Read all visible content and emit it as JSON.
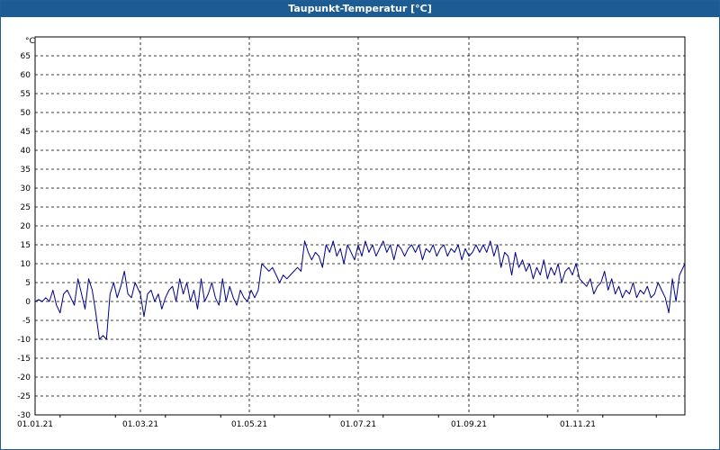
{
  "window": {
    "title": "Taupunkt-Temperatur [°C]"
  },
  "chart_data": {
    "type": "line",
    "title": "Taupunkt-Temperatur [°C]",
    "ylabel": "°C",
    "xlabel": "",
    "ylim": [
      -30,
      70
    ],
    "xlim": [
      "2021-01-01",
      "2021-12-31"
    ],
    "grid": true,
    "yticks": [
      65,
      60,
      55,
      50,
      45,
      40,
      35,
      30,
      25,
      20,
      15,
      10,
      5,
      0,
      -5,
      -10,
      -15,
      -20,
      -25,
      -30
    ],
    "xticks": [
      {
        "date": "2021-01-01",
        "label": "01.01.21"
      },
      {
        "date": "2021-03-01",
        "label": "01.03.21"
      },
      {
        "date": "2021-05-01",
        "label": "01.05.21"
      },
      {
        "date": "2021-07-01",
        "label": "01.07.21"
      },
      {
        "date": "2021-09-01",
        "label": "01.09.21"
      },
      {
        "date": "2021-11-01",
        "label": "01.11.21"
      }
    ],
    "series": [
      {
        "color": "#00008b",
        "points": [
          [
            "2021-01-01",
            0
          ],
          [
            "2021-01-03",
            0.5
          ],
          [
            "2021-01-05",
            0
          ],
          [
            "2021-01-07",
            1
          ],
          [
            "2021-01-09",
            0
          ],
          [
            "2021-01-11",
            3
          ],
          [
            "2021-01-13",
            -1
          ],
          [
            "2021-01-15",
            -3
          ],
          [
            "2021-01-17",
            2
          ],
          [
            "2021-01-19",
            3
          ],
          [
            "2021-01-21",
            1
          ],
          [
            "2021-01-23",
            -1
          ],
          [
            "2021-01-25",
            6
          ],
          [
            "2021-01-27",
            2
          ],
          [
            "2021-01-29",
            -2
          ],
          [
            "2021-01-31",
            6
          ],
          [
            "2021-02-02",
            3
          ],
          [
            "2021-02-04",
            -3
          ],
          [
            "2021-02-06",
            -10
          ],
          [
            "2021-02-08",
            -9
          ],
          [
            "2021-02-10",
            -10
          ],
          [
            "2021-02-12",
            2
          ],
          [
            "2021-02-14",
            5
          ],
          [
            "2021-02-16",
            1
          ],
          [
            "2021-02-18",
            4
          ],
          [
            "2021-02-20",
            8
          ],
          [
            "2021-02-22",
            2
          ],
          [
            "2021-02-24",
            1
          ],
          [
            "2021-02-26",
            5
          ],
          [
            "2021-03-01",
            2
          ],
          [
            "2021-03-03",
            -4
          ],
          [
            "2021-03-05",
            2
          ],
          [
            "2021-03-07",
            3
          ],
          [
            "2021-03-09",
            0
          ],
          [
            "2021-03-11",
            2
          ],
          [
            "2021-03-13",
            -2
          ],
          [
            "2021-03-15",
            1
          ],
          [
            "2021-03-17",
            3
          ],
          [
            "2021-03-19",
            4
          ],
          [
            "2021-03-21",
            0
          ],
          [
            "2021-03-23",
            6
          ],
          [
            "2021-03-25",
            2
          ],
          [
            "2021-03-27",
            5
          ],
          [
            "2021-03-29",
            0
          ],
          [
            "2021-03-31",
            3
          ],
          [
            "2021-04-02",
            -2
          ],
          [
            "2021-04-04",
            6
          ],
          [
            "2021-04-06",
            0
          ],
          [
            "2021-04-08",
            2
          ],
          [
            "2021-04-10",
            5
          ],
          [
            "2021-04-12",
            1
          ],
          [
            "2021-04-14",
            -1
          ],
          [
            "2021-04-16",
            6
          ],
          [
            "2021-04-18",
            0
          ],
          [
            "2021-04-20",
            4
          ],
          [
            "2021-04-22",
            1
          ],
          [
            "2021-04-24",
            -1
          ],
          [
            "2021-04-26",
            3
          ],
          [
            "2021-04-28",
            1
          ],
          [
            "2021-04-30",
            0
          ],
          [
            "2021-05-02",
            3
          ],
          [
            "2021-05-04",
            1
          ],
          [
            "2021-05-06",
            3
          ],
          [
            "2021-05-08",
            10
          ],
          [
            "2021-05-10",
            9
          ],
          [
            "2021-05-12",
            8
          ],
          [
            "2021-05-14",
            9
          ],
          [
            "2021-05-16",
            7
          ],
          [
            "2021-05-18",
            5
          ],
          [
            "2021-05-20",
            7
          ],
          [
            "2021-05-22",
            6
          ],
          [
            "2021-05-24",
            7
          ],
          [
            "2021-05-26",
            8
          ],
          [
            "2021-05-28",
            9
          ],
          [
            "2021-05-30",
            8
          ],
          [
            "2021-06-01",
            16
          ],
          [
            "2021-06-03",
            13
          ],
          [
            "2021-06-05",
            11
          ],
          [
            "2021-06-07",
            13
          ],
          [
            "2021-06-09",
            12
          ],
          [
            "2021-06-11",
            9
          ],
          [
            "2021-06-13",
            15
          ],
          [
            "2021-06-15",
            13
          ],
          [
            "2021-06-17",
            16
          ],
          [
            "2021-06-19",
            12
          ],
          [
            "2021-06-21",
            14
          ],
          [
            "2021-06-23",
            10
          ],
          [
            "2021-06-25",
            15
          ],
          [
            "2021-06-27",
            13
          ],
          [
            "2021-06-29",
            11
          ],
          [
            "2021-07-01",
            15
          ],
          [
            "2021-07-03",
            12
          ],
          [
            "2021-07-05",
            16
          ],
          [
            "2021-07-07",
            13
          ],
          [
            "2021-07-09",
            15
          ],
          [
            "2021-07-11",
            12
          ],
          [
            "2021-07-13",
            14
          ],
          [
            "2021-07-15",
            16
          ],
          [
            "2021-07-17",
            13
          ],
          [
            "2021-07-19",
            15
          ],
          [
            "2021-07-21",
            11
          ],
          [
            "2021-07-23",
            15
          ],
          [
            "2021-07-25",
            14
          ],
          [
            "2021-07-27",
            12
          ],
          [
            "2021-07-29",
            14
          ],
          [
            "2021-07-31",
            15
          ],
          [
            "2021-08-02",
            13
          ],
          [
            "2021-08-04",
            15
          ],
          [
            "2021-08-06",
            11
          ],
          [
            "2021-08-08",
            14
          ],
          [
            "2021-08-10",
            13
          ],
          [
            "2021-08-12",
            15
          ],
          [
            "2021-08-14",
            12
          ],
          [
            "2021-08-16",
            14
          ],
          [
            "2021-08-18",
            15
          ],
          [
            "2021-08-20",
            12
          ],
          [
            "2021-08-22",
            14
          ],
          [
            "2021-08-24",
            13
          ],
          [
            "2021-08-26",
            15
          ],
          [
            "2021-08-28",
            11
          ],
          [
            "2021-08-30",
            14
          ],
          [
            "2021-09-01",
            12
          ],
          [
            "2021-09-03",
            13
          ],
          [
            "2021-09-05",
            15
          ],
          [
            "2021-09-07",
            13
          ],
          [
            "2021-09-09",
            15
          ],
          [
            "2021-09-11",
            13
          ],
          [
            "2021-09-13",
            16
          ],
          [
            "2021-09-15",
            12
          ],
          [
            "2021-09-17",
            15
          ],
          [
            "2021-09-19",
            9
          ],
          [
            "2021-09-21",
            13
          ],
          [
            "2021-09-23",
            12
          ],
          [
            "2021-09-25",
            7
          ],
          [
            "2021-09-27",
            13
          ],
          [
            "2021-09-29",
            9
          ],
          [
            "2021-10-01",
            11
          ],
          [
            "2021-10-03",
            8
          ],
          [
            "2021-10-05",
            10
          ],
          [
            "2021-10-07",
            6
          ],
          [
            "2021-10-09",
            9
          ],
          [
            "2021-10-11",
            7
          ],
          [
            "2021-10-13",
            11
          ],
          [
            "2021-10-15",
            6
          ],
          [
            "2021-10-17",
            9
          ],
          [
            "2021-10-19",
            7
          ],
          [
            "2021-10-21",
            10
          ],
          [
            "2021-10-23",
            5
          ],
          [
            "2021-10-25",
            8
          ],
          [
            "2021-10-27",
            9
          ],
          [
            "2021-10-29",
            7
          ],
          [
            "2021-10-31",
            10
          ],
          [
            "2021-11-02",
            6
          ],
          [
            "2021-11-04",
            5
          ],
          [
            "2021-11-06",
            4
          ],
          [
            "2021-11-08",
            6
          ],
          [
            "2021-11-10",
            2
          ],
          [
            "2021-11-12",
            4
          ],
          [
            "2021-11-14",
            5
          ],
          [
            "2021-11-16",
            8
          ],
          [
            "2021-11-18",
            3
          ],
          [
            "2021-11-20",
            6
          ],
          [
            "2021-11-22",
            2
          ],
          [
            "2021-11-24",
            4
          ],
          [
            "2021-11-26",
            1
          ],
          [
            "2021-11-28",
            3
          ],
          [
            "2021-11-30",
            2
          ],
          [
            "2021-12-02",
            5
          ],
          [
            "2021-12-04",
            1
          ],
          [
            "2021-12-06",
            3
          ],
          [
            "2021-12-08",
            2
          ],
          [
            "2021-12-10",
            4
          ],
          [
            "2021-12-12",
            1
          ],
          [
            "2021-12-14",
            2
          ],
          [
            "2021-12-16",
            5
          ],
          [
            "2021-12-18",
            3
          ],
          [
            "2021-12-20",
            1
          ],
          [
            "2021-12-22",
            -3
          ],
          [
            "2021-12-24",
            6
          ],
          [
            "2021-12-26",
            0
          ],
          [
            "2021-12-28",
            7
          ],
          [
            "2021-12-31",
            10
          ]
        ]
      }
    ]
  }
}
